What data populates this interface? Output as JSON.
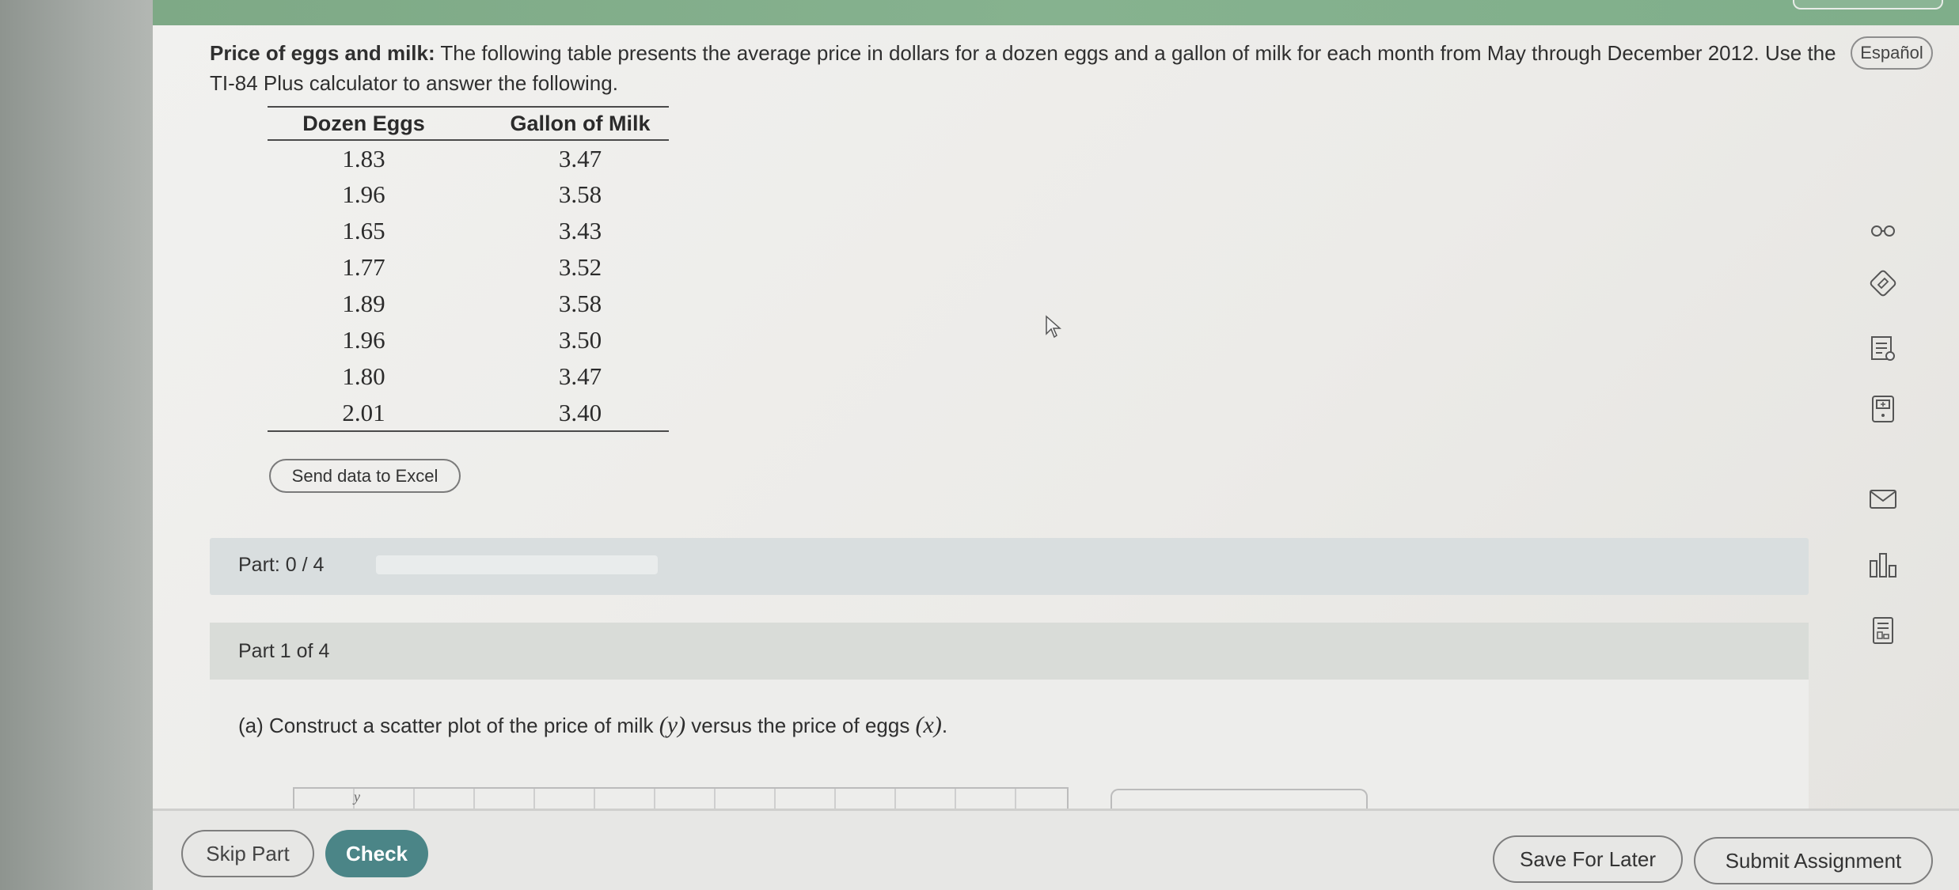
{
  "problem": {
    "title": "Price of eggs and milk:",
    "text": " The following table presents the average price in dollars for a dozen eggs and a gallon of milk for each month from May through December 2012. Use the TI-84 Plus calculator to answer the following."
  },
  "language_button": "Español",
  "table": {
    "headers": [
      "Dozen Eggs",
      "Gallon of Milk"
    ],
    "rows": [
      [
        "1.83",
        "3.47"
      ],
      [
        "1.96",
        "3.58"
      ],
      [
        "1.65",
        "3.43"
      ],
      [
        "1.77",
        "3.52"
      ],
      [
        "1.89",
        "3.58"
      ],
      [
        "1.96",
        "3.50"
      ],
      [
        "1.80",
        "3.47"
      ],
      [
        "2.01",
        "3.40"
      ]
    ]
  },
  "send_excel_label": "Send data to Excel",
  "part_progress": {
    "label": "Part: 0 / 4",
    "fraction": 0
  },
  "part_card": {
    "header": "Part 1 of 4",
    "question_prefix": "(a) Construct a scatter plot of the price of milk ",
    "var_y": "(y)",
    "question_mid": " versus the price of eggs ",
    "var_x": "(x)",
    "question_suffix": ".",
    "plot_axis_label": "y"
  },
  "side_tools": [
    "glasses-icon",
    "edit-answer-icon",
    "notes-icon",
    "calculator-icon",
    "mail-icon",
    "bar-chart-icon",
    "data-table-icon"
  ],
  "buttons": {
    "skip_part": "Skip Part",
    "check": "Check",
    "save_for_later": "Save For Later",
    "submit_assignment": "Submit Assignment"
  },
  "colors": {
    "accent": "#4b8587",
    "progress": "#5c8f8d",
    "header_green": "#86b28f"
  }
}
